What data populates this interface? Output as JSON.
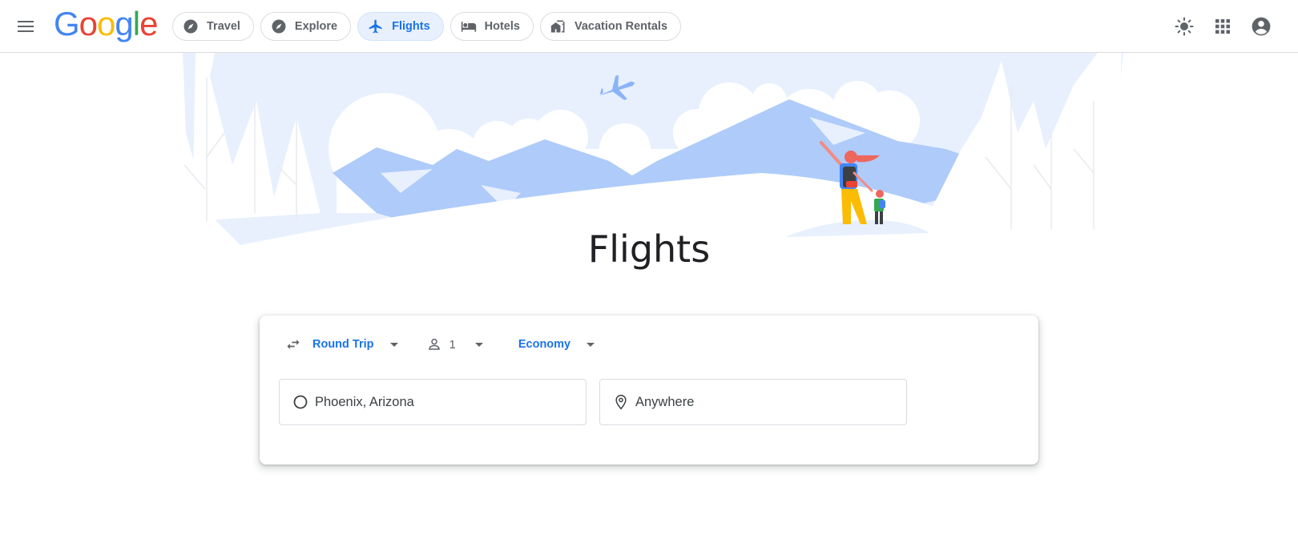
{
  "header": {
    "menu_icon": "hamburger-menu-icon",
    "logo": {
      "letters": [
        "G",
        "o",
        "o",
        "g",
        "l",
        "e"
      ],
      "colors": [
        "#4285f4",
        "#ea4335",
        "#fbbc05",
        "#4285f4",
        "#34a853",
        "#ea4335"
      ]
    },
    "nav_chips": [
      {
        "label": "Travel",
        "icon": "compass-icon",
        "active": false
      },
      {
        "label": "Explore",
        "icon": "explore-icon",
        "active": false
      },
      {
        "label": "Flights",
        "icon": "airplane-icon",
        "active": true
      },
      {
        "label": "Hotels",
        "icon": "bed-icon",
        "active": false
      },
      {
        "label": "Vacation Rentals",
        "icon": "house-icon",
        "active": false
      }
    ],
    "right_icons": [
      "theme-sun-icon",
      "apps-grid-icon",
      "account-icon"
    ]
  },
  "page": {
    "title": "Flights"
  },
  "search": {
    "trip_type": {
      "icon": "swap-arrows-icon",
      "selected": "Round Trip"
    },
    "passengers": {
      "icon": "person-icon",
      "count": "1"
    },
    "cabin_class": {
      "selected": "Economy"
    },
    "origin": {
      "icon": "circle-icon",
      "value": "Phoenix, Arizona"
    },
    "destination": {
      "icon": "location-pin-icon",
      "placeholder": "Anywhere"
    }
  },
  "colors": {
    "accent": "#1a73e8",
    "accent_bg": "#e8f0fe",
    "hero_sky": "#e8f0fe",
    "hero_mountain": "#aecbfa",
    "text": "#3c4043"
  }
}
